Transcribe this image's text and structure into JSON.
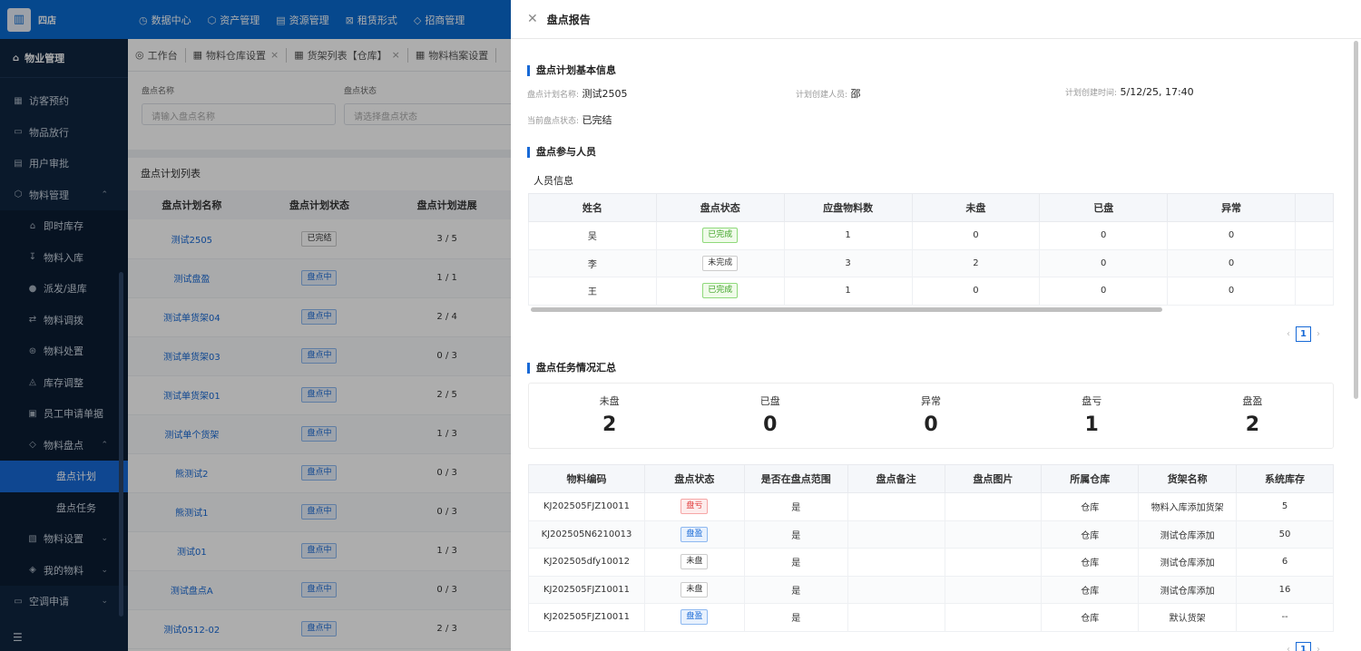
{
  "app": {
    "logo_icon": "building-icon",
    "brand": "四店"
  },
  "sidebar": {
    "top": {
      "icon": "home-icon",
      "label": "物业管理"
    },
    "items": [
      {
        "icon": "calendar-icon",
        "label": "访客预约",
        "level": 0
      },
      {
        "icon": "box-icon",
        "label": "物品放行",
        "level": 0
      },
      {
        "icon": "doc-icon",
        "label": "用户审批",
        "level": 0
      },
      {
        "icon": "cube-icon",
        "label": "物料管理",
        "level": 0,
        "chevron": "⌃"
      },
      {
        "icon": "warehouse-icon",
        "label": "即时库存",
        "level": 1
      },
      {
        "icon": "inbound-icon",
        "label": "物料入库",
        "level": 1
      },
      {
        "icon": "dispatch-icon",
        "label": "派发/退库",
        "level": 1
      },
      {
        "icon": "transfer-icon",
        "label": "物料调拨",
        "level": 1
      },
      {
        "icon": "dispose-icon",
        "label": "物料处置",
        "level": 1
      },
      {
        "icon": "adjust-icon",
        "label": "库存调整",
        "level": 1
      },
      {
        "icon": "form-icon",
        "label": "员工申请单据",
        "level": 1
      },
      {
        "icon": "inventory-icon",
        "label": "物料盘点",
        "level": 1,
        "chevron": "⌃"
      },
      {
        "icon": "",
        "label": "盘点计划",
        "level": 2,
        "active": true
      },
      {
        "icon": "",
        "label": "盘点任务",
        "level": 2
      },
      {
        "icon": "settings-icon",
        "label": "物料设置",
        "level": 1,
        "chevron": "⌄"
      },
      {
        "icon": "mine-icon",
        "label": "我的物料",
        "level": 1,
        "chevron": "⌄"
      },
      {
        "icon": "aircon-icon",
        "label": "空调申请",
        "level": 0,
        "chevron": "⌄"
      }
    ],
    "bottom_icon": "menu-collapse-icon"
  },
  "topnav": [
    {
      "icon": "◷",
      "label": "数据中心"
    },
    {
      "icon": "⬡",
      "label": "资产管理"
    },
    {
      "icon": "▤",
      "label": "资源管理"
    },
    {
      "icon": "⊠",
      "label": "租赁形式"
    },
    {
      "icon": "◇",
      "label": "招商管理"
    }
  ],
  "tabs": [
    {
      "label": "工作台",
      "icon": "◎",
      "closable": false
    },
    {
      "label": "物料仓库设置",
      "icon": "▦",
      "closable": true
    },
    {
      "label": "货架列表【仓库】",
      "icon": "▦",
      "closable": true
    },
    {
      "label": "物料档案设置",
      "icon": "▦",
      "closable": false
    }
  ],
  "search": {
    "name_label": "盘点名称",
    "name_placeholder": "请输入盘点名称",
    "status_label": "盘点状态",
    "status_placeholder": "请选择盘点状态"
  },
  "plan_list": {
    "title": "盘点计划列表",
    "columns": [
      "盘点计划名称",
      "盘点计划状态",
      "盘点计划进展"
    ],
    "rows": [
      {
        "name": "测试2505",
        "status": "已完结",
        "tag": "plain",
        "progress": "3 / 5"
      },
      {
        "name": "测试盘盈",
        "status": "盘点中",
        "tag": "blue",
        "progress": "1 / 1"
      },
      {
        "name": "测试单货架04",
        "status": "盘点中",
        "tag": "blue",
        "progress": "2 / 4"
      },
      {
        "name": "测试单货架03",
        "status": "盘点中",
        "tag": "blue",
        "progress": "0 / 3"
      },
      {
        "name": "测试单货架01",
        "status": "盘点中",
        "tag": "blue",
        "progress": "2 / 5"
      },
      {
        "name": "测试单个货架",
        "status": "盘点中",
        "tag": "blue",
        "progress": "1 / 3"
      },
      {
        "name": "熊测试2",
        "status": "盘点中",
        "tag": "blue",
        "progress": "0 / 3"
      },
      {
        "name": "熊测试1",
        "status": "盘点中",
        "tag": "blue",
        "progress": "0 / 3"
      },
      {
        "name": "测试01",
        "status": "盘点中",
        "tag": "blue",
        "progress": "1 / 3"
      },
      {
        "name": "测试盘点A",
        "status": "盘点中",
        "tag": "blue",
        "progress": "0 / 3"
      },
      {
        "name": "测试0512-02",
        "status": "盘点中",
        "tag": "blue",
        "progress": "2 / 3"
      }
    ]
  },
  "drawer": {
    "title": "盘点报告",
    "basic": {
      "section": "盘点计划基本信息",
      "plan_name_key": "盘点计划名称:",
      "plan_name": "测试2505",
      "creator_key": "计划创建人员:",
      "creator": "邵",
      "created_key": "计划创建时间:",
      "created": "5/12/25, 17:40",
      "status_key": "当前盘点状态:",
      "status": "已完结"
    },
    "participants": {
      "section": "盘点参与人员",
      "subtitle": "人员信息",
      "columns": [
        "姓名",
        "盘点状态",
        "应盘物料数",
        "未盘",
        "已盘",
        "异常"
      ],
      "rows": [
        {
          "name": "吴",
          "status": "已完成",
          "tag": "green",
          "total": "1",
          "pending": "0",
          "done": "0",
          "abnormal": "0"
        },
        {
          "name": "李",
          "status": "未完成",
          "tag": "plain",
          "total": "3",
          "pending": "2",
          "done": "0",
          "abnormal": "0"
        },
        {
          "name": "王",
          "status": "已完成",
          "tag": "green",
          "total": "1",
          "pending": "0",
          "done": "0",
          "abnormal": "0"
        }
      ],
      "page": "1"
    },
    "summary": {
      "section": "盘点任务情况汇总",
      "cells": [
        {
          "label": "未盘",
          "value": "2"
        },
        {
          "label": "已盘",
          "value": "0"
        },
        {
          "label": "异常",
          "value": "0"
        },
        {
          "label": "盘亏",
          "value": "1"
        },
        {
          "label": "盘盈",
          "value": "2"
        }
      ]
    },
    "tasks": {
      "columns": [
        "物料编码",
        "盘点状态",
        "是否在盘点范围",
        "盘点备注",
        "盘点图片",
        "所属仓库",
        "货架名称",
        "系统库存"
      ],
      "rows": [
        {
          "code": "KJ202505FJZ10011",
          "status": "盘亏",
          "tag": "red",
          "in_scope": "是",
          "remark": "",
          "image": "",
          "warehouse": "仓库",
          "shelf": "物料入库添加货架",
          "stock": "5"
        },
        {
          "code": "KJ202505N6210013",
          "status": "盘盈",
          "tag": "blue",
          "in_scope": "是",
          "remark": "",
          "image": "",
          "warehouse": "仓库",
          "shelf": "测试仓库添加",
          "stock": "50"
        },
        {
          "code": "KJ202505dfy10012",
          "status": "未盘",
          "tag": "plain",
          "in_scope": "是",
          "remark": "",
          "image": "",
          "warehouse": "仓库",
          "shelf": "测试仓库添加",
          "stock": "6"
        },
        {
          "code": "KJ202505FJZ10011",
          "status": "未盘",
          "tag": "plain",
          "in_scope": "是",
          "remark": "",
          "image": "",
          "warehouse": "仓库",
          "shelf": "测试仓库添加",
          "stock": "16"
        },
        {
          "code": "KJ202505FJZ10011",
          "status": "盘盈",
          "tag": "blue",
          "in_scope": "是",
          "remark": "",
          "image": "",
          "warehouse": "仓库",
          "shelf": "默认货架",
          "stock": "--"
        }
      ],
      "page": "1"
    }
  }
}
